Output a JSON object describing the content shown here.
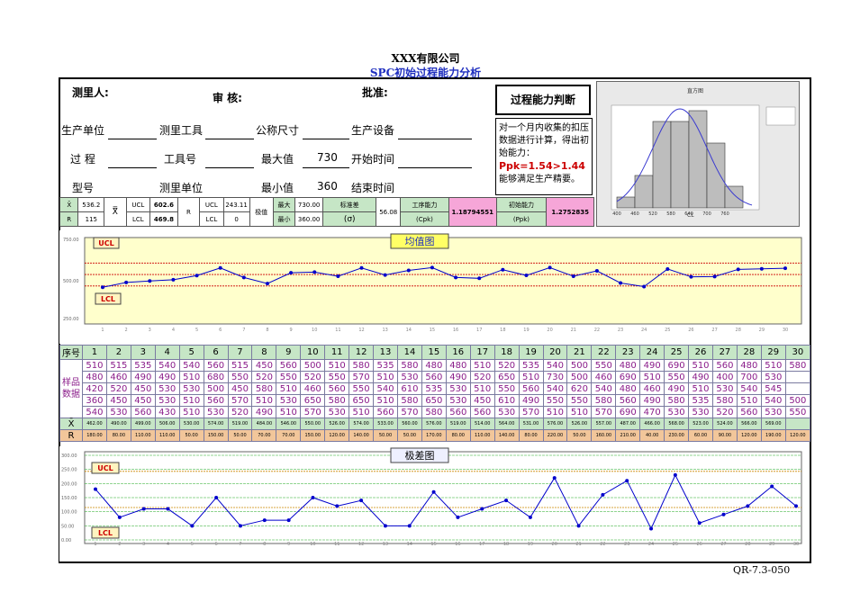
{
  "header": {
    "title": "XXX有限公司",
    "subtitle": "SPC初始过程能力分析"
  },
  "form": {
    "measurer": "测里人:",
    "reviewer": "审  核:",
    "approver": "批准:",
    "prod_unit": "生产单位",
    "measure_tool": "测里工具",
    "nominal": "公称尺寸",
    "equipment": "生产设备",
    "process": "过  程",
    "tool_no": "工具号",
    "max_label": "最大值",
    "max_value": "730",
    "start_time": "开始时间",
    "model": "型号",
    "measure_unit": "测里单位",
    "min_label": "最小值",
    "min_value": "360",
    "end_time": "结束时间"
  },
  "judgement": {
    "title": "过程能力判断",
    "text": "对一个月内收集的扣压数据进行计算，得出初始能力：",
    "result": "Ppk=1.54>1.44",
    "conclusion": "能够满足生产精要。"
  },
  "stats": {
    "xbar_sym": "X̄",
    "xbar": "536.2",
    "r_sym": "R",
    "r": "115",
    "xbarbar": "X̿",
    "ucl": "UCL",
    "ucl_x": "602.6",
    "lcl": "LCL",
    "lcl_x": "469.8",
    "r_col": "R",
    "ucl_r": "243.11",
    "lcl_r": "0",
    "extreme": "极值",
    "max": "最大",
    "max_v": "730.00",
    "min": "最小",
    "min_v": "360.00",
    "std_label": "标准差",
    "sigma": "(σ)",
    "std": "56.08",
    "cpk_label": "工序能力",
    "cpk_sub": "(Cpk)",
    "cpk": "1.18794551",
    "ppk_label": "初始能力",
    "ppk_sub": "(Ppk)",
    "ppk": "1.2752835"
  },
  "xbar_chart": {
    "title": "均值图",
    "ucl": "UCL",
    "lcl": "LCL",
    "y_top": "750.00",
    "y_mid": "500.00",
    "y_bot": "250.00"
  },
  "r_chart": {
    "title": "极差图",
    "ucl": "UCL",
    "lcl": "LCL",
    "yticks": [
      "300.00",
      "250.00",
      "200.00",
      "150.00",
      "100.00",
      "50.00",
      "0.00"
    ]
  },
  "data": {
    "seq_label": "序号",
    "sample_label": "样品数据",
    "xbar_label": "X̄",
    "r_label": "R",
    "samples": [
      [
        "510",
        "515",
        "535",
        "540",
        "540",
        "560",
        "515",
        "450",
        "560",
        "500",
        "510",
        "580",
        "535",
        "580",
        "480",
        "480",
        "510",
        "520",
        "535",
        "540",
        "500",
        "550",
        "480",
        "490",
        "690",
        "510",
        "560",
        "480",
        "510",
        "580"
      ],
      [
        "480",
        "460",
        "490",
        "490",
        "510",
        "680",
        "550",
        "520",
        "550",
        "520",
        "550",
        "570",
        "510",
        "530",
        "560",
        "490",
        "520",
        "650",
        "510",
        "730",
        "500",
        "460",
        "690",
        "510",
        "550",
        "490",
        "400",
        "700",
        "530"
      ],
      [
        "420",
        "520",
        "450",
        "530",
        "530",
        "500",
        "450",
        "580",
        "510",
        "460",
        "560",
        "550",
        "540",
        "610",
        "535",
        "530",
        "510",
        "550",
        "560",
        "540",
        "620",
        "540",
        "480",
        "460",
        "490",
        "510",
        "530",
        "540",
        "545"
      ],
      [
        "360",
        "450",
        "450",
        "530",
        "510",
        "560",
        "570",
        "510",
        "530",
        "650",
        "580",
        "650",
        "510",
        "580",
        "650",
        "530",
        "450",
        "610",
        "490",
        "550",
        "550",
        "580",
        "560",
        "490",
        "580",
        "535",
        "580",
        "510",
        "540",
        "500"
      ],
      [
        "540",
        "530",
        "560",
        "430",
        "510",
        "530",
        "520",
        "490",
        "510",
        "570",
        "530",
        "510",
        "560",
        "570",
        "580",
        "560",
        "560",
        "530",
        "570",
        "510",
        "510",
        "570",
        "690",
        "470",
        "530",
        "530",
        "520",
        "560",
        "530",
        "550"
      ]
    ],
    "xbar": [
      "462.00",
      "490.00",
      "499.00",
      "506.00",
      "530.00",
      "574.00",
      "519.00",
      "484.00",
      "546.00",
      "550.00",
      "526.00",
      "574.00",
      "533.00",
      "560.00",
      "576.00",
      "519.00",
      "514.00",
      "564.00",
      "531.00",
      "576.00",
      "526.00",
      "557.00",
      "487.00",
      "466.00",
      "568.00",
      "523.00",
      "524.00",
      "566.00",
      "569.00"
    ],
    "r": [
      "180.00",
      "80.00",
      "110.00",
      "110.00",
      "50.00",
      "150.00",
      "50.00",
      "70.00",
      "70.00",
      "150.00",
      "120.00",
      "140.00",
      "50.00",
      "50.00",
      "170.00",
      "80.00",
      "110.00",
      "140.00",
      "80.00",
      "220.00",
      "50.00",
      "160.00",
      "210.00",
      "40.00",
      "230.00",
      "60.00",
      "90.00",
      "120.00",
      "190.00",
      "120.00"
    ]
  },
  "chart_data": [
    {
      "type": "line",
      "title": "均值图",
      "x": [
        1,
        2,
        3,
        4,
        5,
        6,
        7,
        8,
        9,
        10,
        11,
        12,
        13,
        14,
        15,
        16,
        17,
        18,
        19,
        20,
        21,
        22,
        23,
        24,
        25,
        26,
        27,
        28,
        29,
        30
      ],
      "values": [
        462,
        490,
        499,
        506,
        530,
        574,
        519,
        484,
        546,
        550,
        526,
        574,
        533,
        560,
        576,
        519,
        514,
        564,
        531,
        576,
        526,
        557,
        487,
        466,
        568,
        523,
        524,
        566,
        569,
        572
      ],
      "ucl": 602.6,
      "lcl": 469.8,
      "center": 536.2,
      "ylim": [
        250,
        750
      ]
    },
    {
      "type": "line",
      "title": "极差图",
      "x": [
        1,
        2,
        3,
        4,
        5,
        6,
        7,
        8,
        9,
        10,
        11,
        12,
        13,
        14,
        15,
        16,
        17,
        18,
        19,
        20,
        21,
        22,
        23,
        24,
        25,
        26,
        27,
        28,
        29,
        30
      ],
      "values": [
        180,
        80,
        110,
        110,
        50,
        150,
        50,
        70,
        70,
        150,
        120,
        140,
        50,
        50,
        170,
        80,
        110,
        140,
        80,
        220,
        50,
        160,
        210,
        40,
        230,
        60,
        90,
        120,
        190,
        120
      ],
      "ucl": 243.11,
      "lcl": 0,
      "center": 115,
      "ylim": [
        0,
        300
      ]
    },
    {
      "type": "bar",
      "title": "直方图",
      "categories": [
        "400",
        "460",
        "520",
        "580",
        "640",
        "700",
        "760"
      ],
      "values": [
        1,
        3,
        8,
        8,
        9,
        6,
        2
      ],
      "xlabel": "CL"
    }
  ],
  "footer": {
    "ref": "QR-7.3-050"
  },
  "colors": {
    "accent": "#1f2fbf",
    "line": "#0000cc",
    "red": "#cc0000",
    "panel": "#ffffcc"
  }
}
